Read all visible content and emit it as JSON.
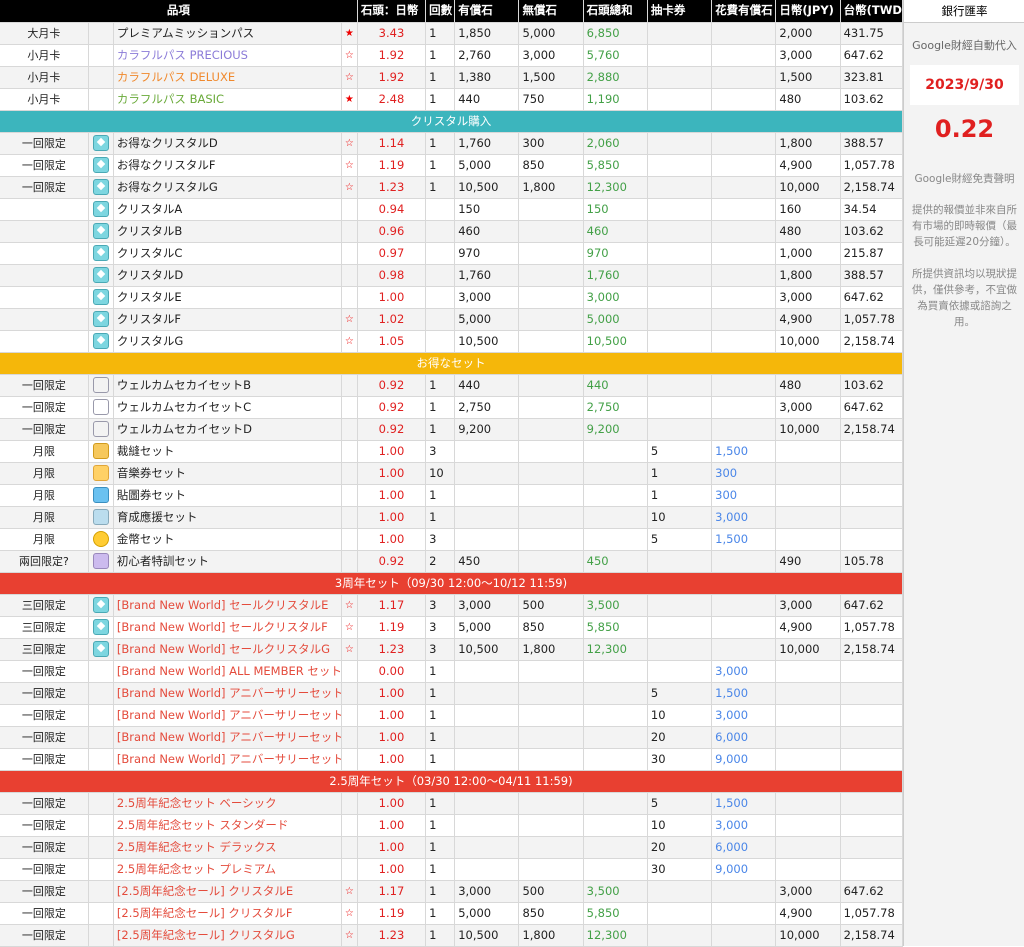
{
  "headers": {
    "item": "品項",
    "ratio": "石頭：日幣",
    "count": "回數",
    "paid": "有償石",
    "free": "無償石",
    "total": "石頭總和",
    "gacha": "抽卡券",
    "cost": "花費有償石",
    "jpy": "日幣(JPY)",
    "twd": "台幣(TWD)"
  },
  "sections": {
    "crystal": "クリスタル購入",
    "set": "お得なセット",
    "anniv3": "3周年セット（09/30 12:00～10/12 11:59)",
    "anniv25": "2.5周年セット（03/30 12:00～04/11 11:59)"
  },
  "rows": {
    "monthly": [
      {
        "type": "大月卡",
        "name": "プレミアムミッションパス",
        "color": "",
        "star": "★",
        "ratio": "3.43",
        "count": "1",
        "paid": "1,850",
        "free": "5,000",
        "total": "6,850",
        "gacha": "",
        "cost": "",
        "jpy": "2,000",
        "twd": "431.75"
      },
      {
        "type": "小月卡",
        "name": "カラフルパス PRECIOUS",
        "color": "n-purple",
        "star": "☆",
        "ratio": "1.92",
        "count": "1",
        "paid": "2,760",
        "free": "3,000",
        "total": "5,760",
        "gacha": "",
        "cost": "",
        "jpy": "3,000",
        "twd": "647.62"
      },
      {
        "type": "小月卡",
        "name": "カラフルパス DELUXE",
        "color": "n-orange",
        "star": "☆",
        "ratio": "1.92",
        "count": "1",
        "paid": "1,380",
        "free": "1,500",
        "total": "2,880",
        "gacha": "",
        "cost": "",
        "jpy": "1,500",
        "twd": "323.81"
      },
      {
        "type": "小月卡",
        "name": "カラフルパス BASIC",
        "color": "n-green",
        "star": "★",
        "ratio": "2.48",
        "count": "1",
        "paid": "440",
        "free": "750",
        "total": "1,190",
        "gacha": "",
        "cost": "",
        "jpy": "480",
        "twd": "103.62"
      }
    ],
    "crystal": [
      {
        "type": "一回限定",
        "name": "お得なクリスタルD",
        "icon": "crystal",
        "star": "☆",
        "ratio": "1.14",
        "count": "1",
        "paid": "1,760",
        "free": "300",
        "total": "2,060",
        "gacha": "",
        "cost": "",
        "jpy": "1,800",
        "twd": "388.57"
      },
      {
        "type": "一回限定",
        "name": "お得なクリスタルF",
        "icon": "crystal",
        "star": "☆",
        "ratio": "1.19",
        "count": "1",
        "paid": "5,000",
        "free": "850",
        "total": "5,850",
        "gacha": "",
        "cost": "",
        "jpy": "4,900",
        "twd": "1,057.78"
      },
      {
        "type": "一回限定",
        "name": "お得なクリスタルG",
        "icon": "crystal",
        "star": "☆",
        "ratio": "1.23",
        "count": "1",
        "paid": "10,500",
        "free": "1,800",
        "total": "12,300",
        "gacha": "",
        "cost": "",
        "jpy": "10,000",
        "twd": "2,158.74"
      },
      {
        "type": "",
        "name": "クリスタルA",
        "icon": "crystal",
        "star": "",
        "ratio": "0.94",
        "count": "",
        "paid": "150",
        "free": "",
        "total": "150",
        "gacha": "",
        "cost": "",
        "jpy": "160",
        "twd": "34.54"
      },
      {
        "type": "",
        "name": "クリスタルB",
        "icon": "crystal",
        "star": "",
        "ratio": "0.96",
        "count": "",
        "paid": "460",
        "free": "",
        "total": "460",
        "gacha": "",
        "cost": "",
        "jpy": "480",
        "twd": "103.62"
      },
      {
        "type": "",
        "name": "クリスタルC",
        "icon": "crystal",
        "star": "",
        "ratio": "0.97",
        "count": "",
        "paid": "970",
        "free": "",
        "total": "970",
        "gacha": "",
        "cost": "",
        "jpy": "1,000",
        "twd": "215.87"
      },
      {
        "type": "",
        "name": "クリスタルD",
        "icon": "crystal",
        "star": "",
        "ratio": "0.98",
        "count": "",
        "paid": "1,760",
        "free": "",
        "total": "1,760",
        "gacha": "",
        "cost": "",
        "jpy": "1,800",
        "twd": "388.57"
      },
      {
        "type": "",
        "name": "クリスタルE",
        "icon": "crystal",
        "star": "",
        "ratio": "1.00",
        "count": "",
        "paid": "3,000",
        "free": "",
        "total": "3,000",
        "gacha": "",
        "cost": "",
        "jpy": "3,000",
        "twd": "647.62"
      },
      {
        "type": "",
        "name": "クリスタルF",
        "icon": "crystal",
        "star": "☆",
        "ratio": "1.02",
        "count": "",
        "paid": "5,000",
        "free": "",
        "total": "5,000",
        "gacha": "",
        "cost": "",
        "jpy": "4,900",
        "twd": "1,057.78"
      },
      {
        "type": "",
        "name": "クリスタルG",
        "icon": "crystal",
        "star": "☆",
        "ratio": "1.05",
        "count": "",
        "paid": "10,500",
        "free": "",
        "total": "10,500",
        "gacha": "",
        "cost": "",
        "jpy": "10,000",
        "twd": "2,158.74"
      }
    ],
    "set": [
      {
        "type": "一回限定",
        "name": "ウェルカムセカイセットB",
        "icon": "set",
        "star": "",
        "ratio": "0.92",
        "count": "1",
        "paid": "440",
        "free": "",
        "total": "440",
        "gacha": "",
        "cost": "",
        "jpy": "480",
        "twd": "103.62"
      },
      {
        "type": "一回限定",
        "name": "ウェルカムセカイセットC",
        "icon": "set",
        "star": "",
        "ratio": "0.92",
        "count": "1",
        "paid": "2,750",
        "free": "",
        "total": "2,750",
        "gacha": "",
        "cost": "",
        "jpy": "3,000",
        "twd": "647.62"
      },
      {
        "type": "一回限定",
        "name": "ウェルカムセカイセットD",
        "icon": "set",
        "star": "",
        "ratio": "0.92",
        "count": "1",
        "paid": "9,200",
        "free": "",
        "total": "9,200",
        "gacha": "",
        "cost": "",
        "jpy": "10,000",
        "twd": "2,158.74"
      },
      {
        "type": "月限",
        "name": "裁縫セット",
        "icon": "cloth",
        "star": "",
        "ratio": "1.00",
        "count": "3",
        "paid": "",
        "free": "",
        "total": "",
        "gacha": "5",
        "cost": "1,500",
        "jpy": "",
        "twd": ""
      },
      {
        "type": "月限",
        "name": "音樂券セット",
        "icon": "music",
        "star": "",
        "ratio": "1.00",
        "count": "10",
        "paid": "",
        "free": "",
        "total": "",
        "gacha": "1",
        "cost": "300",
        "jpy": "",
        "twd": ""
      },
      {
        "type": "月限",
        "name": "貼圖券セット",
        "icon": "ticket",
        "star": "",
        "ratio": "1.00",
        "count": "1",
        "paid": "",
        "free": "",
        "total": "",
        "gacha": "1",
        "cost": "300",
        "jpy": "",
        "twd": ""
      },
      {
        "type": "月限",
        "name": "育成應援セット",
        "icon": "support",
        "star": "",
        "ratio": "1.00",
        "count": "1",
        "paid": "",
        "free": "",
        "total": "",
        "gacha": "10",
        "cost": "3,000",
        "jpy": "",
        "twd": ""
      },
      {
        "type": "月限",
        "name": "金幣セット",
        "icon": "coin",
        "star": "",
        "ratio": "1.00",
        "count": "3",
        "paid": "",
        "free": "",
        "total": "",
        "gacha": "5",
        "cost": "1,500",
        "jpy": "",
        "twd": ""
      },
      {
        "type": "兩回限定?",
        "name": "初心者特訓セット",
        "icon": "beginner",
        "star": "",
        "ratio": "0.92",
        "count": "2",
        "paid": "450",
        "free": "",
        "total": "450",
        "gacha": "",
        "cost": "",
        "jpy": "490",
        "twd": "105.78"
      }
    ],
    "anniv3": [
      {
        "type": "三回限定",
        "name": "[Brand New World] セールクリスタルE",
        "icon": "crystal",
        "star": "☆",
        "ratio": "1.17",
        "count": "3",
        "paid": "3,000",
        "free": "500",
        "total": "3,500",
        "gacha": "",
        "cost": "",
        "jpy": "3,000",
        "twd": "647.62"
      },
      {
        "type": "三回限定",
        "name": "[Brand New World] セールクリスタルF",
        "icon": "crystal",
        "star": "☆",
        "ratio": "1.19",
        "count": "3",
        "paid": "5,000",
        "free": "850",
        "total": "5,850",
        "gacha": "",
        "cost": "",
        "jpy": "4,900",
        "twd": "1,057.78"
      },
      {
        "type": "三回限定",
        "name": "[Brand New World] セールクリスタルG",
        "icon": "crystal",
        "star": "☆",
        "ratio": "1.23",
        "count": "3",
        "paid": "10,500",
        "free": "1,800",
        "total": "12,300",
        "gacha": "",
        "cost": "",
        "jpy": "10,000",
        "twd": "2,158.74"
      },
      {
        "type": "一回限定",
        "name": "[Brand New World] ALL MEMBER セット",
        "icon": "",
        "star": "",
        "ratio": "0.00",
        "count": "1",
        "paid": "",
        "free": "",
        "total": "",
        "gacha": "",
        "cost": "3,000",
        "jpy": "",
        "twd": ""
      },
      {
        "type": "一回限定",
        "name": "[Brand New World] アニバーサリーセット",
        "icon": "",
        "star": "",
        "ratio": "1.00",
        "count": "1",
        "paid": "",
        "free": "",
        "total": "",
        "gacha": "5",
        "cost": "1,500",
        "jpy": "",
        "twd": ""
      },
      {
        "type": "一回限定",
        "name": "[Brand New World] アニバーサリーセット",
        "icon": "",
        "star": "",
        "ratio": "1.00",
        "count": "1",
        "paid": "",
        "free": "",
        "total": "",
        "gacha": "10",
        "cost": "3,000",
        "jpy": "",
        "twd": ""
      },
      {
        "type": "一回限定",
        "name": "[Brand New World] アニバーサリーセット",
        "icon": "",
        "star": "",
        "ratio": "1.00",
        "count": "1",
        "paid": "",
        "free": "",
        "total": "",
        "gacha": "20",
        "cost": "6,000",
        "jpy": "",
        "twd": ""
      },
      {
        "type": "一回限定",
        "name": "[Brand New World] アニバーサリーセット",
        "icon": "",
        "star": "",
        "ratio": "1.00",
        "count": "1",
        "paid": "",
        "free": "",
        "total": "",
        "gacha": "30",
        "cost": "9,000",
        "jpy": "",
        "twd": ""
      }
    ],
    "anniv25": [
      {
        "type": "一回限定",
        "name": "2.5周年紀念セット ベーシック",
        "icon": "",
        "star": "",
        "ratio": "1.00",
        "count": "1",
        "paid": "",
        "free": "",
        "total": "",
        "gacha": "5",
        "cost": "1,500",
        "jpy": "",
        "twd": ""
      },
      {
        "type": "一回限定",
        "name": "2.5周年紀念セット スタンダード",
        "icon": "",
        "star": "",
        "ratio": "1.00",
        "count": "1",
        "paid": "",
        "free": "",
        "total": "",
        "gacha": "10",
        "cost": "3,000",
        "jpy": "",
        "twd": ""
      },
      {
        "type": "一回限定",
        "name": "2.5周年紀念セット デラックス",
        "icon": "",
        "star": "",
        "ratio": "1.00",
        "count": "1",
        "paid": "",
        "free": "",
        "total": "",
        "gacha": "20",
        "cost": "6,000",
        "jpy": "",
        "twd": ""
      },
      {
        "type": "一回限定",
        "name": "2.5周年紀念セット プレミアム",
        "icon": "",
        "star": "",
        "ratio": "1.00",
        "count": "1",
        "paid": "",
        "free": "",
        "total": "",
        "gacha": "30",
        "cost": "9,000",
        "jpy": "",
        "twd": ""
      },
      {
        "type": "一回限定",
        "name": "[2.5周年紀念セール] クリスタルE",
        "icon": "",
        "star": "☆",
        "ratio": "1.17",
        "count": "1",
        "paid": "3,000",
        "free": "500",
        "total": "3,500",
        "gacha": "",
        "cost": "",
        "jpy": "3,000",
        "twd": "647.62"
      },
      {
        "type": "一回限定",
        "name": "[2.5周年紀念セール] クリスタルF",
        "icon": "",
        "star": "☆",
        "ratio": "1.19",
        "count": "1",
        "paid": "5,000",
        "free": "850",
        "total": "5,850",
        "gacha": "",
        "cost": "",
        "jpy": "4,900",
        "twd": "1,057.78"
      },
      {
        "type": "一回限定",
        "name": "[2.5周年紀念セール] クリスタルG",
        "icon": "",
        "star": "☆",
        "ratio": "1.23",
        "count": "1",
        "paid": "10,500",
        "free": "1,800",
        "total": "12,300",
        "gacha": "",
        "cost": "",
        "jpy": "10,000",
        "twd": "2,158.74"
      }
    ]
  },
  "sidebar": {
    "header": "銀行匯率",
    "source": "Google財經自動代入",
    "date": "2023/9/30",
    "rate": "0.22",
    "disclaimer_title": "Google財經免責聲明",
    "disclaimer_1": "提供的報價並非來自所有市場的即時報價（最長可能延遲20分鐘）。",
    "disclaimer_2": "所提供資訊均以現狀提供，僅供參考，不宜做為買賣依據或諮詢之用。"
  }
}
